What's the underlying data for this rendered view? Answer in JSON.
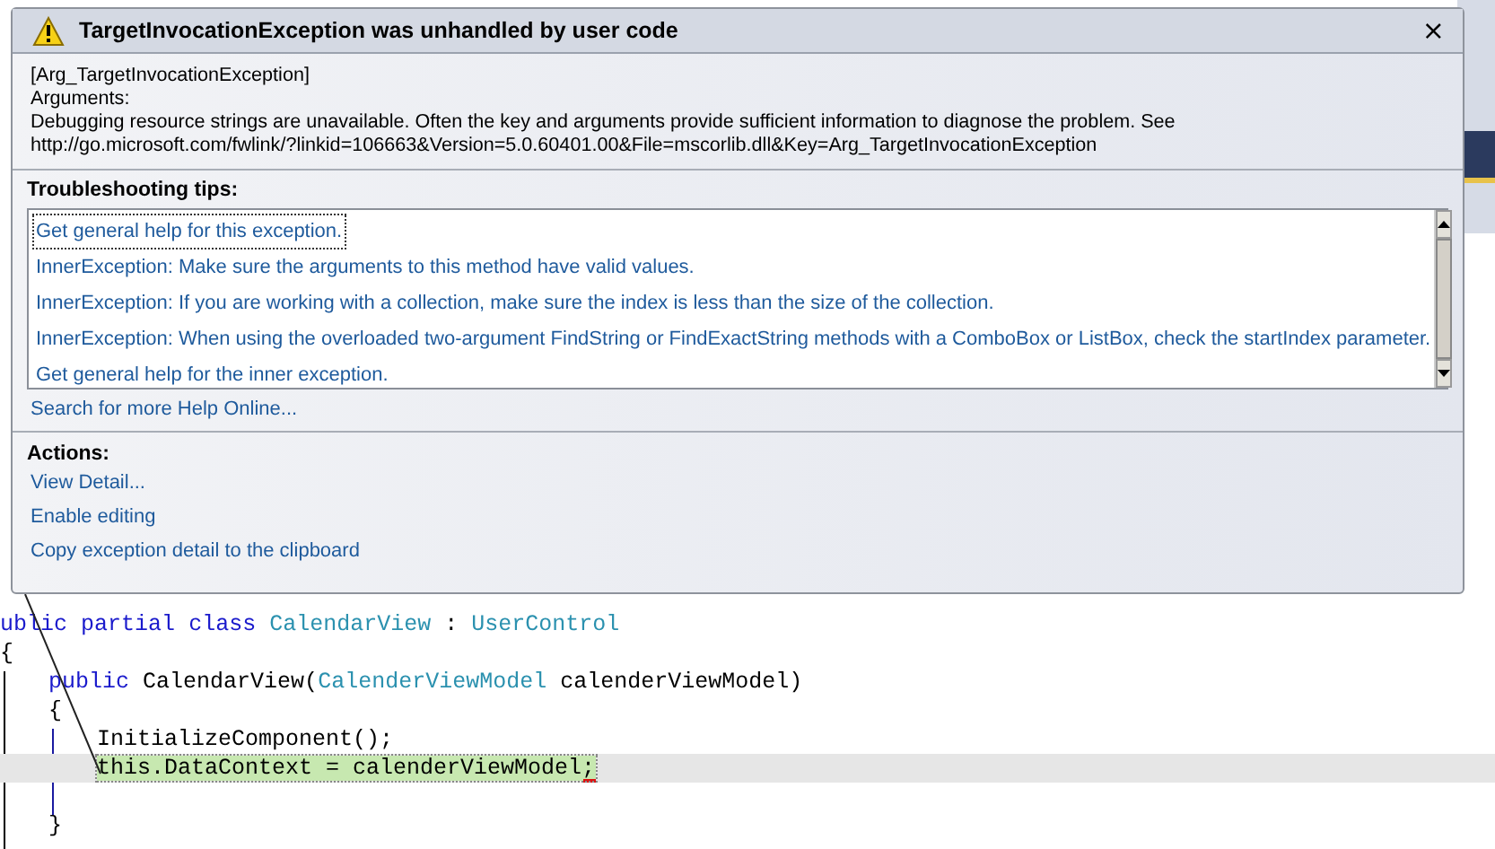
{
  "dialog": {
    "title": "TargetInvocationException was unhandled by user code",
    "close": "×",
    "details": [
      "[Arg_TargetInvocationException]",
      "Arguments:",
      "Debugging resource strings are unavailable. Often the key and arguments provide sufficient information to diagnose the problem. See",
      "http://go.microsoft.com/fwlink/?linkid=106663&Version=5.0.60401.00&File=mscorlib.dll&Key=Arg_TargetInvocationException"
    ],
    "tips_heading": "Troubleshooting tips:",
    "tips": [
      {
        "text": "Get general help for this exception.",
        "focused": true
      },
      {
        "text": "InnerException: Make sure the arguments to this method have valid values.",
        "focused": false
      },
      {
        "text": "InnerException: If you are working with a collection, make sure the index is less than the size of the collection.",
        "focused": false
      },
      {
        "text": "InnerException: When using the overloaded two-argument FindString or FindExactString methods with a ComboBox or ListBox, check the startIndex parameter.",
        "focused": false
      },
      {
        "text": "Get general help for the inner exception.",
        "focused": false
      }
    ],
    "search_link": "Search for more Help Online...",
    "actions_heading": "Actions:",
    "actions": [
      "View Detail...",
      "Enable editing",
      "Copy exception detail to the clipboard"
    ]
  },
  "code_lines": [
    {
      "current": false,
      "tokens": [
        {
          "kind": "keyword",
          "text": "ublic"
        },
        {
          "kind": "keyword",
          "text": "partial"
        },
        {
          "kind": "keyword",
          "text": "class"
        },
        {
          "kind": "type",
          "text": "CalendarView"
        },
        {
          "kind": "plain",
          "text": ":"
        },
        {
          "kind": "type",
          "text": "UserControl"
        }
      ]
    },
    {
      "current": false,
      "tokens": [
        {
          "kind": "plain",
          "text": "{"
        }
      ],
      "children": [
        {
          "current": false,
          "tokens": [
            {
              "kind": "keyword",
              "text": "public"
            },
            {
              "kind": "plain",
              "text": "CalendarView("
            },
            {
              "kind": "type",
              "text": "CalenderViewModel"
            },
            {
              "kind": "plain",
              "text": "calenderViewModel)"
            }
          ]
        },
        {
          "current": false,
          "tokens": [
            {
              "kind": "plain",
              "text": "{"
            }
          ],
          "children": [
            {
              "current": false,
              "tokens": [
                {
                  "kind": "plain",
                  "text": "InitializeComponent();"
                }
              ]
            },
            {
              "current": true,
              "tokens": [
                {
                  "kind": "plain",
                  "text": "this.DataContext = calenderViewModel;"
                }
              ]
            }
          ]
        },
        {
          "current": false,
          "tokens": [
            {
              "kind": "plain",
              "text": "}"
            }
          ]
        }
      ]
    }
  ]
}
